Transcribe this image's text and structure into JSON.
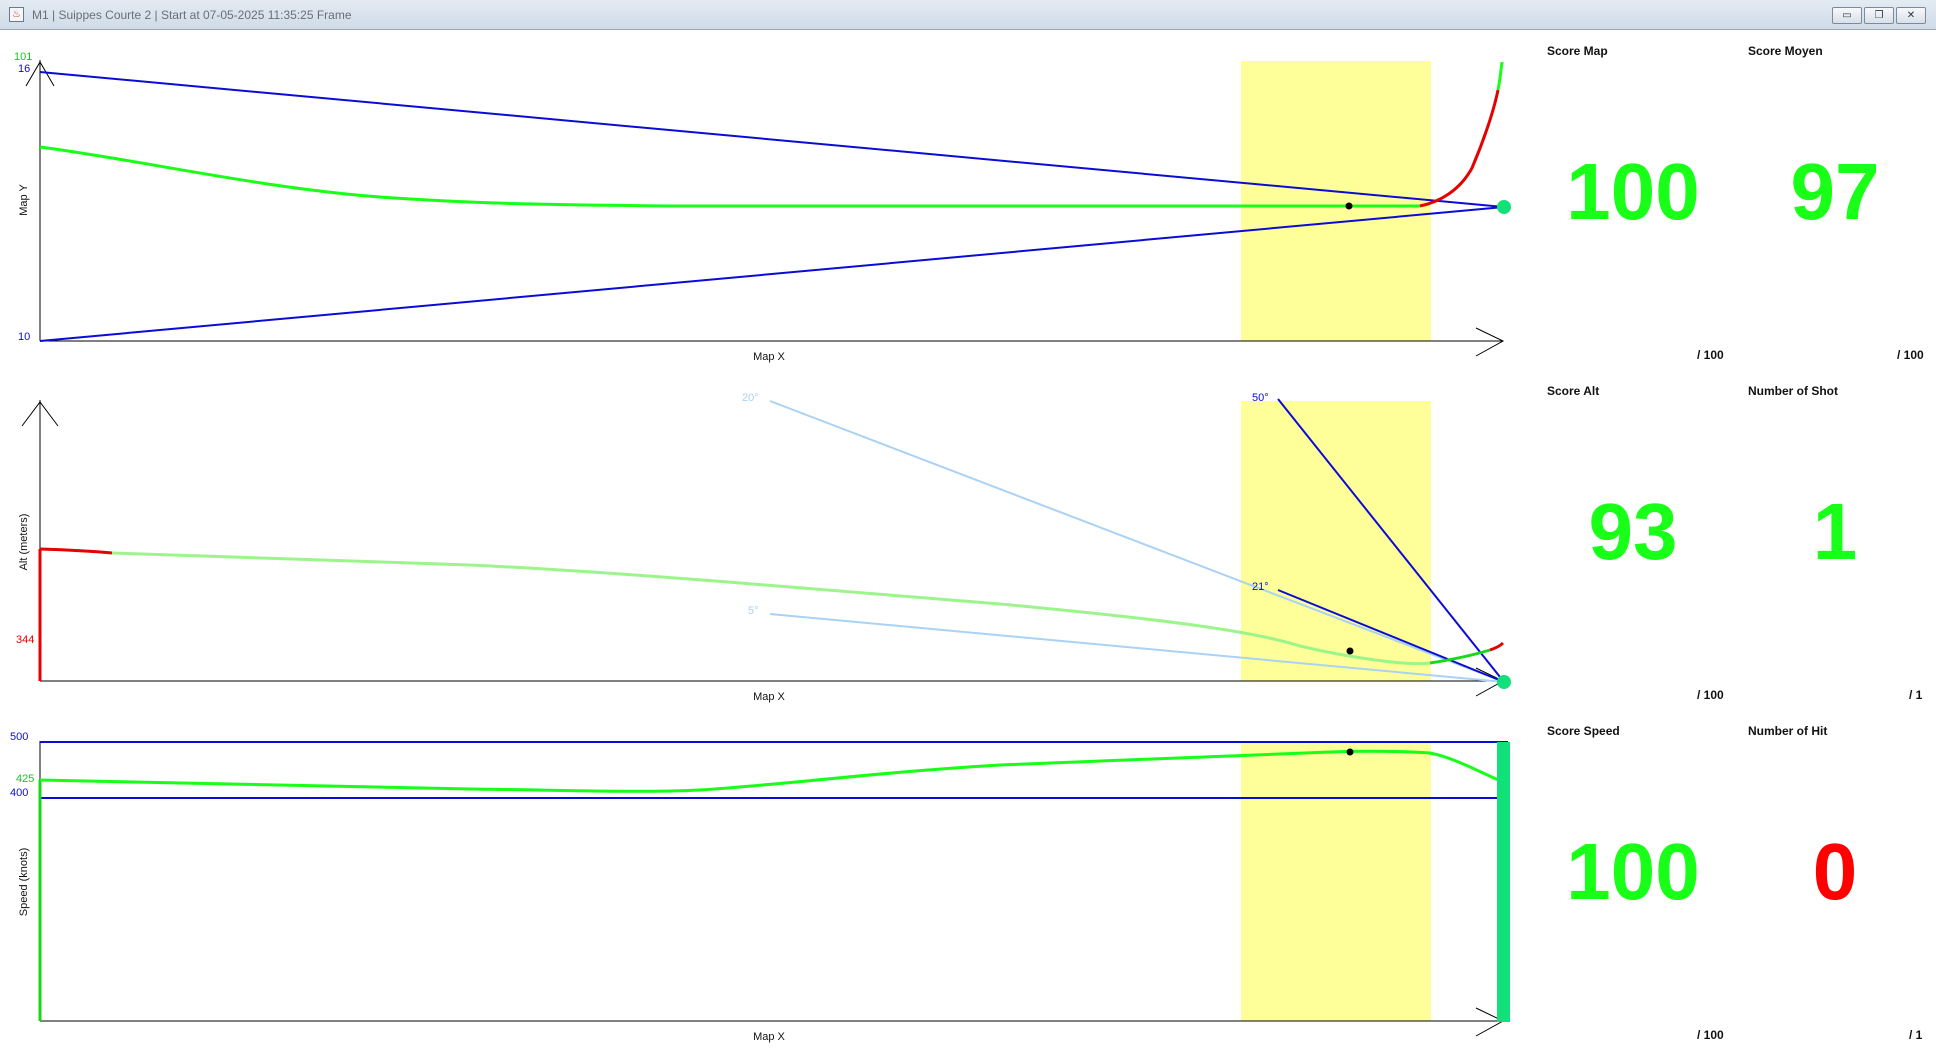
{
  "window": {
    "title": "M1 | Suippes Courte 2 | Start at 07-05-2025 11:35:25 Frame",
    "minimize_icon": "minimize-icon",
    "restore_icon": "restore-icon",
    "close_icon": "close-icon"
  },
  "colors": {
    "good": "#18ff18",
    "bad": "#ff0000",
    "limit_line": "#0b0bd6",
    "light_limit_line": "#a9d2f5",
    "window_zone": "#ffff99",
    "target_dot": "#12e07a"
  },
  "plots": {
    "map": {
      "ylabel": "Map Y",
      "xlabel": "Map X",
      "y_top_label": "101",
      "y_top_label2": "16",
      "y_bottom_label": "10"
    },
    "alt": {
      "ylabel": "Alt (meters)",
      "xlabel": "Map X",
      "current_label": "344",
      "angles": [
        "20°",
        "50°",
        "21°",
        "5°"
      ]
    },
    "speed": {
      "ylabel": "Speed (knots)",
      "xlabel": "Map X",
      "upper_limit_label": "500",
      "current_label": "425",
      "lower_limit_label": "400"
    }
  },
  "scores": [
    {
      "title": "Score Map",
      "value": "100",
      "max": "/ 100",
      "status": "good"
    },
    {
      "title": "Score Moyen",
      "value": "97",
      "max": "/ 100",
      "status": "good"
    },
    {
      "title": "Score Alt",
      "value": "93",
      "max": "/ 100",
      "status": "good"
    },
    {
      "title": "Number of Shot",
      "value": "1",
      "max": "/ 1",
      "status": "good"
    },
    {
      "title": "Score Speed",
      "value": "100",
      "max": "/ 100",
      "status": "good"
    },
    {
      "title": "Number of Hit",
      "value": "0",
      "max": "/ 1",
      "status": "bad"
    }
  ]
}
